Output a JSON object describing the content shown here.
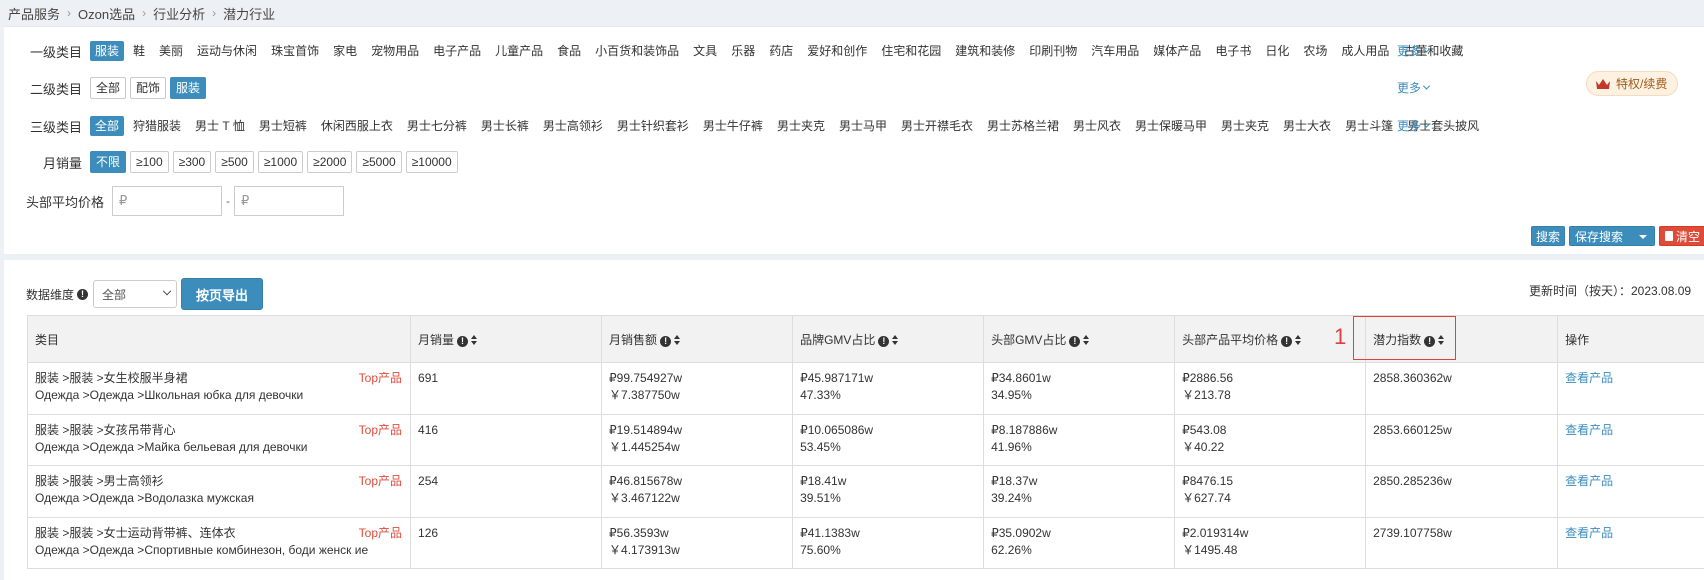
{
  "breadcrumb": [
    "产品服务",
    "Ozon选品",
    "行业分析",
    "潜力行业"
  ],
  "filters": {
    "level1": {
      "label": "一级类目",
      "options": [
        "服装",
        "鞋",
        "美丽",
        "运动与休闲",
        "珠宝首饰",
        "家电",
        "宠物用品",
        "电子产品",
        "儿童产品",
        "食品",
        "小百货和装饰品",
        "文具",
        "乐器",
        "药店",
        "爱好和创作",
        "住宅和花园",
        "建筑和装修",
        "印刷刊物",
        "汽车用品",
        "媒体产品",
        "电子书",
        "日化",
        "农场",
        "成人用品",
        "古董和收藏"
      ],
      "selected": 0,
      "more": "更多"
    },
    "level2": {
      "label": "二级类目",
      "options": [
        "全部",
        "配饰",
        "服装"
      ],
      "selected": 2,
      "more": "更多"
    },
    "level3": {
      "label": "三级类目",
      "options": [
        "全部",
        "狩猎服装",
        "男士 T 恤",
        "男士短裤",
        "休闲西服上衣",
        "男士七分裤",
        "男士长裤",
        "男士高领衫",
        "男士针织套衫",
        "男士牛仔裤",
        "男士夹克",
        "男士马甲",
        "男士开襟毛衣",
        "男士苏格兰裙",
        "男士风衣",
        "男士保暖马甲",
        "男士夹克",
        "男士大衣",
        "男士斗篷",
        "男士套头披风"
      ],
      "selected": 0,
      "more": "更多"
    },
    "sales": {
      "label": "月销量",
      "options": [
        "不限",
        "≥100",
        "≥300",
        "≥500",
        "≥1000",
        "≥2000",
        "≥5000",
        "≥10000"
      ],
      "selected": 0
    },
    "price": {
      "label": "头部平均价格",
      "min_placeholder": "₽",
      "max_placeholder": "₽",
      "dash": "-"
    }
  },
  "vip_label": "特权/续费",
  "buttons": {
    "search": "搜索",
    "save_search": "保存搜索",
    "clear": "清空"
  },
  "toolbar": {
    "dim_label": "数据维度",
    "dim_value": "全部",
    "export": "按页导出",
    "update": "更新时间（按天）：2023.08.09"
  },
  "table": {
    "headers": [
      "类目",
      "月销量",
      "月销售额",
      "品牌GMV占比",
      "头部GMV占比",
      "头部产品平均价格",
      "潜力指数",
      "操作"
    ],
    "rows": [
      {
        "cat_cn": "服装 >服装 >女生校服半身裙",
        "cat_ru": "Одежда >Одежда >Школьная юбка для девочки",
        "top": "Top产品",
        "sales": "691",
        "rev1": "₽99.754927w",
        "rev2": "￥7.387750w",
        "brand1": "₽45.987171w",
        "brand2": "47.33%",
        "head1": "₽34.8601w",
        "head2": "34.95%",
        "avg1": "₽2886.56",
        "avg2": "￥213.78",
        "idx": "2858.360362w",
        "op": "查看产品"
      },
      {
        "cat_cn": "服装 >服装 >女孩吊带背心",
        "cat_ru": "Одежда >Одежда >Майка бельевая для девочки",
        "top": "Top产品",
        "sales": "416",
        "rev1": "₽19.514894w",
        "rev2": "￥1.445254w",
        "brand1": "₽10.065086w",
        "brand2": "53.45%",
        "head1": "₽8.187886w",
        "head2": "41.96%",
        "avg1": "₽543.08",
        "avg2": "￥40.22",
        "idx": "2853.660125w",
        "op": "查看产品"
      },
      {
        "cat_cn": "服装 >服装 >男士高领衫",
        "cat_ru": "Одежда >Одежда >Водолазка мужская",
        "top": "Top产品",
        "sales": "254",
        "rev1": "₽46.815678w",
        "rev2": "￥3.467122w",
        "brand1": "₽18.41w",
        "brand2": "39.51%",
        "head1": "₽18.37w",
        "head2": "39.24%",
        "avg1": "₽8476.15",
        "avg2": "￥627.74",
        "idx": "2850.285236w",
        "op": "查看产品"
      },
      {
        "cat_cn": "服装 >服装 >女士运动背带裤、连体衣",
        "cat_ru": "Одежда >Одежда >Спортивные комбинезон, боди женск ие",
        "top": "Top产品",
        "sales": "126",
        "rev1": "₽56.3593w",
        "rev2": "￥4.173913w",
        "brand1": "₽41.1383w",
        "brand2": "75.60%",
        "head1": "₽35.0902w",
        "head2": "62.26%",
        "avg1": "₽2.019314w",
        "avg2": "￥1495.48",
        "idx": "2739.107758w",
        "op": "查看产品"
      }
    ]
  },
  "annotation": {
    "number": "1"
  }
}
